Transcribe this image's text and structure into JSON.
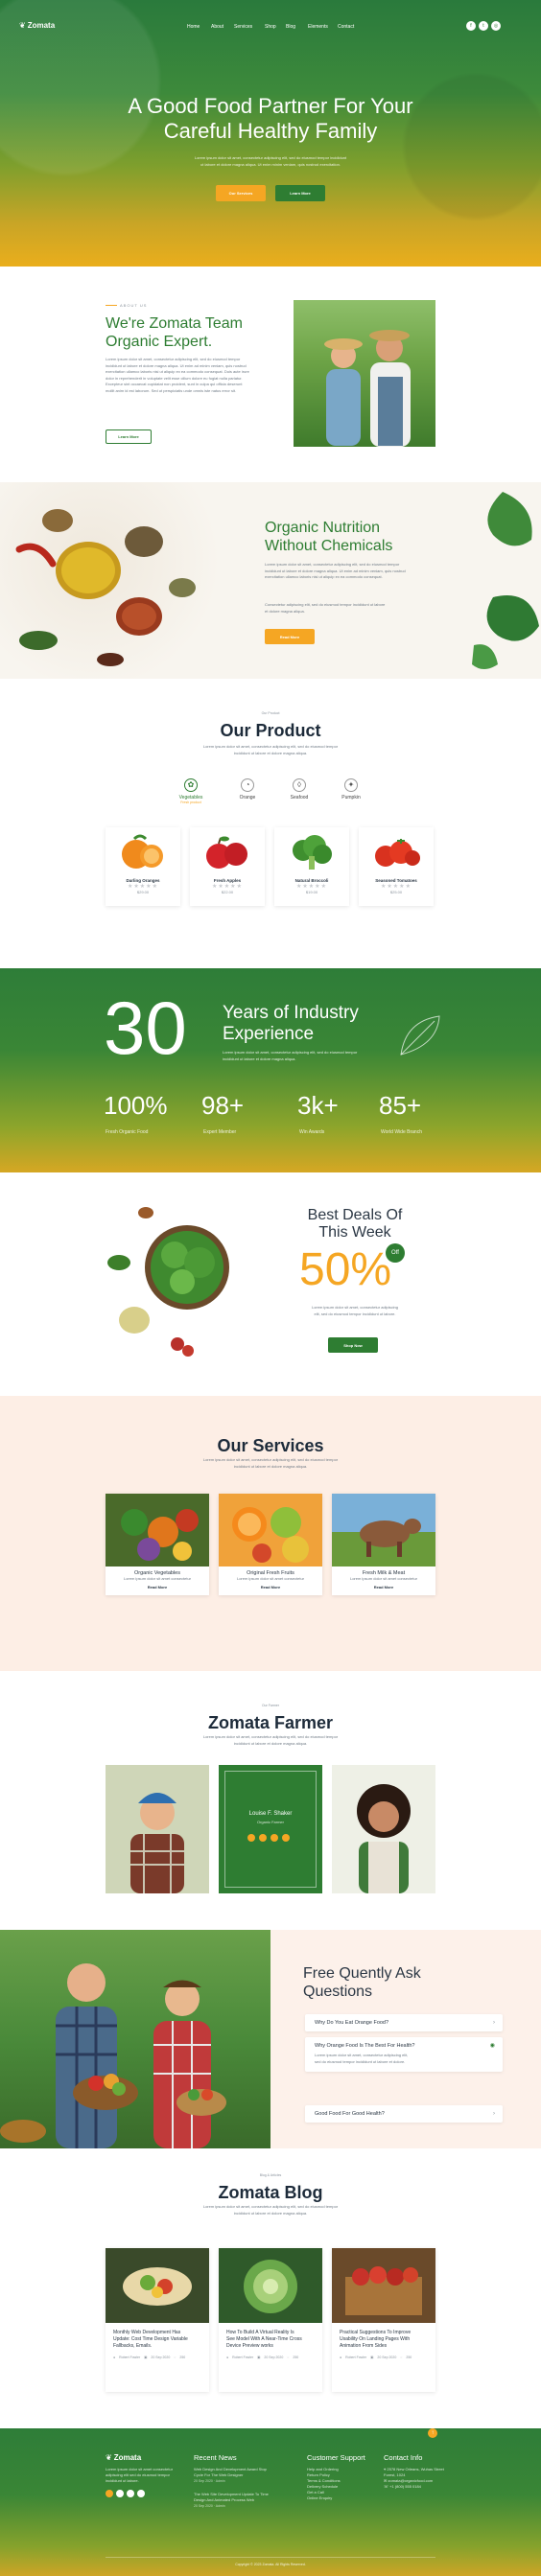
{
  "brand": {
    "name": "Zomata"
  },
  "nav": {
    "items": [
      "Home",
      "About",
      "Services",
      "Shop",
      "Blog",
      "Elements",
      "Contact"
    ]
  },
  "social": {
    "icons": [
      "facebook-icon",
      "twitter-icon",
      "instagram-icon"
    ],
    "glyphs": [
      "f",
      "t",
      "◎"
    ]
  },
  "hero": {
    "title_line1": "A Good Food Partner For Your",
    "title_line2": "Careful Healthy Family",
    "text_line1": "Lorem ipsum dolor sit amet, consectetur adipiscing elit, sed do eiusmod tempor incididunt",
    "text_line2": "ut labore et dolore magna aliqua. Ut enim minim veniam, quis nostrud exercitation.",
    "btn_primary": "Our Services",
    "btn_secondary": "Learn More"
  },
  "about": {
    "eyebrow": "ABOUT US",
    "title_line1": "We're Zomata Team",
    "title_line2": "Organic Expert.",
    "para": [
      "Lorem ipsum dolor sit amet, consectetur adipiscing elit, sed do eiusmod tempor",
      "incididunt ut labore et dolore magna aliqua. Ut enim ad minim veniam, quis nostrud",
      "exercitation ullamco laboris nisi ut aliquip ex ea commodo consequat. Duis aute irure",
      "dolor in reprehenderit in voluptate velit esse cillum dolore eu fugiat nulla pariatur.",
      "Excepteur sint occaecat cupidatat non proident, sunt in culpa qui officia deserunt",
      "mollit anim id est laborum. Sed ut perspiciatis unde omnis iste natus error sit."
    ],
    "btn": "Learn More"
  },
  "nutrition": {
    "title_line1": "Organic Nutrition",
    "title_line2": "Without Chemicals",
    "para1": [
      "Lorem ipsum dolor sit amet, consectetur adipiscing elit, sed do eiusmod tempor",
      "incididunt ut labore et dolore magna aliqua. Ut enim ad minim veniam, quis nostrud",
      "exercitation ullamco laboris nisi ut aliquip ex ea commodo consequat."
    ],
    "para2": [
      "Consectetur adipiscing elit, sed do eiusmod tempor incididunt ut labore",
      "et dolore magna aliqua."
    ],
    "btn": "Read More"
  },
  "products": {
    "eyebrow": "Our Product",
    "title": "Our Product",
    "sub_line1": "Lorem ipsum dolor sit amet, consectetur adipiscing elit, sed do eiusmod tempor",
    "sub_line2": "incididunt ut labore et dolore magna aliqua.",
    "tabs": [
      {
        "label": "Vegetables",
        "sub": "Fresh product",
        "icon": "vegetable-icon"
      },
      {
        "label": "Orange",
        "sub": "",
        "icon": "orange-icon"
      },
      {
        "label": "Seafood",
        "sub": "",
        "icon": "seafood-icon"
      },
      {
        "label": "Pumpkin",
        "sub": "",
        "icon": "pumpkin-icon"
      }
    ],
    "items": [
      {
        "name": "Darling Oranges",
        "price": "$29.00"
      },
      {
        "name": "Fresh Apples",
        "price": "$22.00"
      },
      {
        "name": "Natural Broccoli",
        "price": "$19.00"
      },
      {
        "name": "Seasoned Tomatoes",
        "price": "$25.00"
      }
    ],
    "stars": "★★★★★"
  },
  "stats": {
    "big": "30",
    "title_line1": "Years of Industry",
    "title_line2": "Experience",
    "sub_line1": "Lorem ipsum dolor sit amet, consectetur adipiscing elit, sed do eiusmod tempor",
    "sub_line2": "incididunt ut labore et dolore magna aliqua.",
    "items": [
      {
        "value": "100%",
        "label": "Fresh Organic Food"
      },
      {
        "value": "98+",
        "label": "Expert Member"
      },
      {
        "value": "3k+",
        "label": "Win Awards"
      },
      {
        "value": "85+",
        "label": "World Wide Branch"
      }
    ]
  },
  "deals": {
    "title_line1": "Best Deals Of",
    "title_line2": "This Week",
    "percent": "50%",
    "off": "Off",
    "sub_line1": "Lorem ipsum dolor sit amet, consectetur adipiscing",
    "sub_line2": "elit, sed do eiusmod tempor incididunt ut labore.",
    "btn": "Shop Now"
  },
  "services": {
    "title": "Our Services",
    "sub_line1": "Lorem ipsum dolor sit amet, consectetur adipiscing elit, sed do eiusmod tempor",
    "sub_line2": "incididunt ut labore et dolore magna aliqua.",
    "items": [
      {
        "name": "Organic Vegetables",
        "line1": "Lorem ipsum dolor sit amet consectetur",
        "line2": "adipiscing elit sed do eiusmod tempor.",
        "link": "Read More"
      },
      {
        "name": "Original Fresh Fruits",
        "line1": "Lorem ipsum dolor sit amet consectetur",
        "line2": "adipiscing elit sed do eiusmod tempor.",
        "link": "Read More"
      },
      {
        "name": "Fresh Milk & Meat",
        "line1": "Lorem ipsum dolor sit amet consectetur",
        "line2": "adipiscing elit sed do eiusmod tempor.",
        "link": "Read More"
      }
    ]
  },
  "farmer": {
    "eyebrow": "Our Farmer",
    "title": "Zomata Farmer",
    "sub_line1": "Lorem ipsum dolor sit amet, consectetur adipiscing elit, sed do eiusmod tempor",
    "sub_line2": "incididunt ut labore et dolore magna aliqua.",
    "featured_name": "Louise F. Shaker",
    "featured_role": "Organic Farmer"
  },
  "faq": {
    "title_line1": "Free Quently Ask",
    "title_line2": "Questions",
    "items": [
      "Why Do You Eat Orange Food?",
      "Why Orange Food Is The Best For Health?",
      "Good Food For Good Health?"
    ],
    "answer_line1": "Lorem ipsum dolor sit amet, consectetur adipiscing elit,",
    "answer_line2": "sed do eiusmod tempor incididunt ut labore et dolore."
  },
  "blog": {
    "eyebrow": "Blog & Articles",
    "title": "Zomata Blog",
    "sub_line1": "Lorem ipsum dolor sit amet, consectetur adipiscing elit, sed do eiusmod tempor",
    "sub_line2": "incididunt ut labore et dolore magna aliqua.",
    "posts": [
      {
        "line1": "Monthly Web Development Has",
        "line2": "Update: Cost Time Design Variable",
        "line3": "Fallbacks, Emails.",
        "author": "Robert Fowler",
        "date": "20 Sep 2020",
        "comments": "250"
      },
      {
        "line1": "How To Build A Virtual Reality Is",
        "line2": "See Model With A Near-Time Cross",
        "line3": "Device Preview works",
        "author": "Robert Fowler",
        "date": "20 Sep 2020",
        "comments": "250"
      },
      {
        "line1": "Practical Suggestions To Improve",
        "line2": "Usability On Landing Pages With",
        "line3": "Animation From Sides",
        "author": "Robert Fowler",
        "date": "20 Sep 2020",
        "comments": "250"
      }
    ]
  },
  "footer": {
    "about_line1": "Lorem ipsum dolor sit amet consectetur",
    "about_line2": "adipiscing elit sed do eiusmod tempor",
    "about_line3": "incididunt ut labore.",
    "news_title": "Recent News",
    "news": [
      {
        "line1": "Web Design And Development Award Stop",
        "line2": "Cycle For The Web Designer",
        "date": "20 Sep 2020",
        "author": "Admin"
      },
      {
        "line1": "The Web Site Development Update To Time",
        "line2": "Design And Animated Process Web",
        "date": "20 Sep 2020",
        "author": "Admin"
      }
    ],
    "support_title": "Customer Support",
    "support": [
      "Help and Ordering",
      "Return Policy",
      "Terms & Conditions",
      "Delivery Schedule",
      "Get a Call",
      "Online Enquiry"
    ],
    "contact_title": "Contact Info",
    "contact": [
      "2578 New Orleans, Wuhas Street Forest, 1024",
      "zomata@organicfood.com",
      "+1 (800) 555 0184"
    ],
    "copyright": "Copyright © 2023 Zomata. All Rights Reserved."
  },
  "colors": {
    "green": "#2e7d32",
    "orange": "#f5a623",
    "dark": "#1d2b3a",
    "cream": "#fdeee5"
  }
}
